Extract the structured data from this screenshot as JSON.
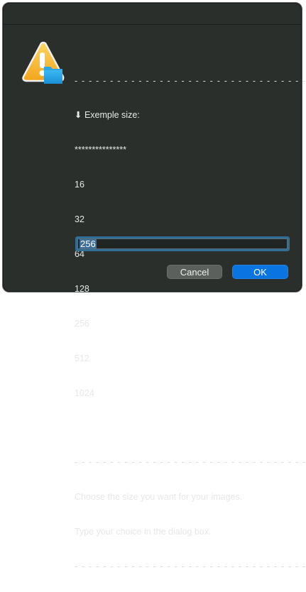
{
  "dialog": {
    "icon": "caution-folder-icon",
    "separator_top": "- - - - - - - - - - - - - - - - - - - - - - - - - - - - - - - - - -",
    "heading": "⬇ Exemple size:",
    "stars": "***************",
    "sizes": [
      "16",
      "32",
      "64",
      "128",
      "256",
      "512",
      "1024"
    ],
    "separator_mid": "- - - - - - - - - - - - - - - - - - - - - - - - - - - - - - - - - -",
    "prompt_line1": "Choose the size you want for your images.",
    "prompt_line2": "Type your choice in the dialog box.",
    "separator_bottom": "- - - - - - - - - - - - - - - - - - - - - - - - - - - - - - - - - -",
    "input_value": "256",
    "cancel_label": "Cancel",
    "ok_label": "OK"
  },
  "colors": {
    "background": "#2a2f2b",
    "accent": "#0a74e0",
    "focus_ring": "#2f6f95"
  }
}
